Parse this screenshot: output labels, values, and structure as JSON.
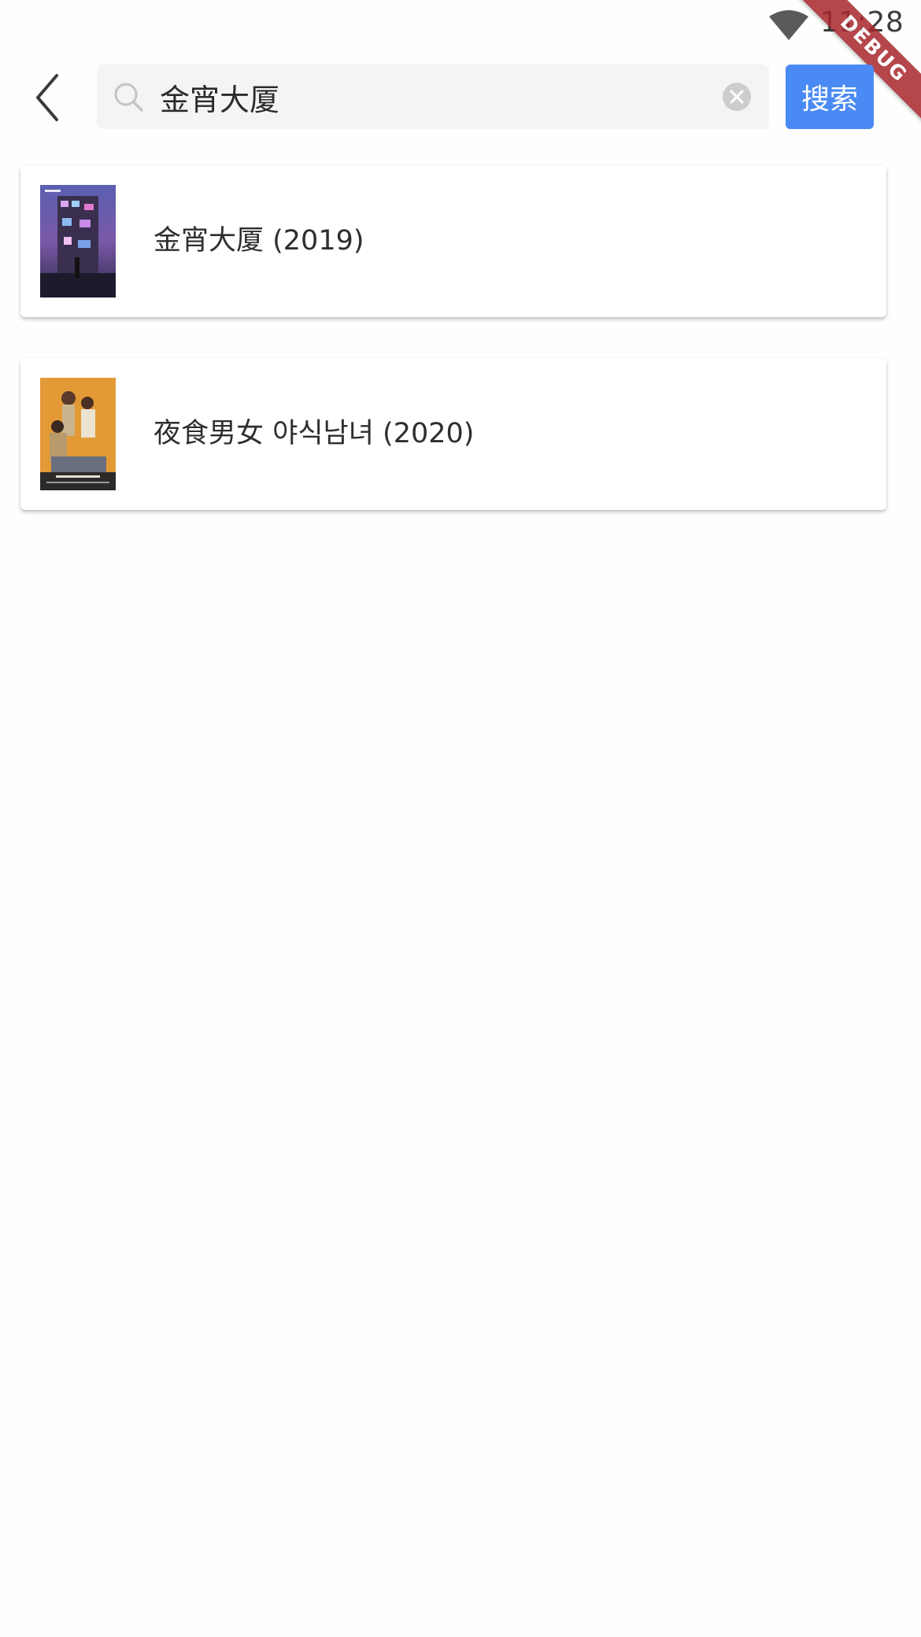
{
  "status_bar": {
    "time": "11:28",
    "wifi_icon": "wifi-icon"
  },
  "debug_banner": {
    "label": "DEBUG",
    "color": "#a8262e"
  },
  "header": {
    "back_icon": "chevron-left-icon",
    "search_icon": "search-icon",
    "clear_icon": "clear-circle-icon",
    "search_value": "金宵大厦",
    "search_button_label": "搜索",
    "accent_color": "#4a8af4"
  },
  "results": [
    {
      "title": "金宵大厦 (2019)",
      "poster_icon": "poster-thumbnail"
    },
    {
      "title": "夜食男女 야식남녀 (2020)",
      "poster_icon": "poster-thumbnail"
    }
  ]
}
